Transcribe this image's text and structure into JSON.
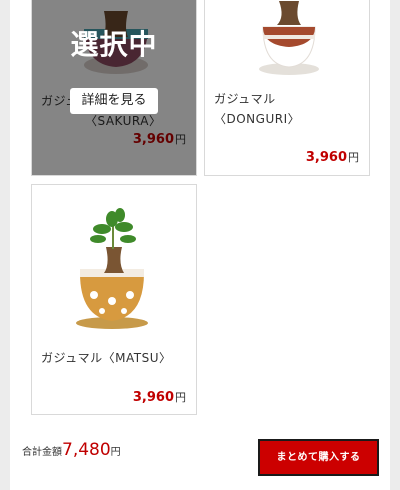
{
  "products": [
    {
      "name_line1": "ガジュマル",
      "name_line2": "〈SAKURA〉",
      "price": "3,960",
      "currency": "円",
      "selected": true,
      "selected_label": "選択中",
      "detail_label": "詳細を見る"
    },
    {
      "name_line1": "ガジュマル",
      "name_line2": "〈DONGURI〉",
      "price": "3,960",
      "currency": "円"
    },
    {
      "name": "ガジュマル〈MATSU〉",
      "price": "3,960",
      "currency": "円"
    }
  ],
  "footer": {
    "total_label": "合計金額",
    "total_value": "7,480",
    "total_currency": "円",
    "buy_label": "まとめて購入する"
  },
  "colors": {
    "price_red": "#c00000",
    "buy_button": "#cc0000"
  }
}
